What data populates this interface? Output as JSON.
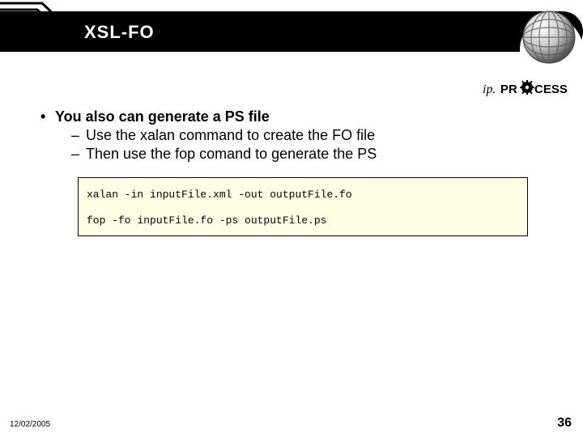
{
  "header": {
    "title": "XSL-FO"
  },
  "logo": {
    "text_ip": "ip.",
    "text_process_pre": "PR",
    "text_process_post": "CESS"
  },
  "content": {
    "bullet1": "You also can generate a PS file",
    "sub1": "Use the xalan command to create the FO file",
    "sub2": "Then use the fop comand to generate the PS",
    "code_line1": "xalan -in inputFile.xml -out outputFile.fo",
    "code_line2": "fop -fo inputFile.fo -ps outputFile.ps"
  },
  "footer": {
    "date": "12/02/2005",
    "page": "36"
  }
}
